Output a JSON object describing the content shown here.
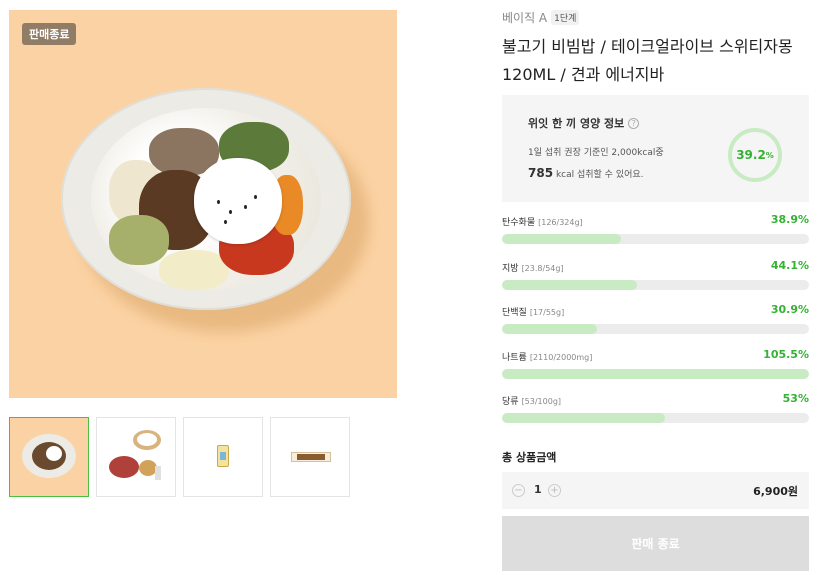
{
  "badge": {
    "sold_out": "판매종료"
  },
  "brand": {
    "name": "베이직 A",
    "level": "1단계"
  },
  "product": {
    "title_line1": "불고기 비빔밥 / 테이크얼라이브 스위티자몽",
    "title_line2": "120ML / 견과 에너지바"
  },
  "nutrition": {
    "title": "위잇 한 끼 영양 정보",
    "help_icon": "question-circle-icon",
    "description": "1일 섭취 권장 기준인 2,000kcal중",
    "kcal_value": "785",
    "kcal_suffix": "kcal 섭취할 수 있어요.",
    "ratio_value": "39.2",
    "ratio_unit": "%",
    "ratio": 0.392
  },
  "nutrients": [
    {
      "name": "탄수화물",
      "detail": "[126/324g]",
      "pct": "38.9%",
      "level": 38.9
    },
    {
      "name": "지방",
      "detail": "[23.8/54g]",
      "pct": "44.1%",
      "level": 44.1
    },
    {
      "name": "단백질",
      "detail": "[17/55g]",
      "pct": "30.9%",
      "level": 30.9
    },
    {
      "name": "나트륨",
      "detail": "[2110/2000mg]",
      "pct": "105.5%",
      "level": 100
    },
    {
      "name": "당류",
      "detail": "[53/100g]",
      "pct": "53%",
      "level": 53
    }
  ],
  "order": {
    "total_label": "총 상품금액",
    "quantity": "1",
    "minus": "−",
    "plus": "+",
    "price": "6,900원",
    "button": "판매 종료"
  },
  "thumbnails": [
    "bibimbap-bowl",
    "meal-set",
    "drink-pouch",
    "energy-bar"
  ],
  "colors": {
    "accent": "#34b233",
    "bar_fill": "#c8ebc3",
    "image_bg": "#fbd2a3"
  }
}
